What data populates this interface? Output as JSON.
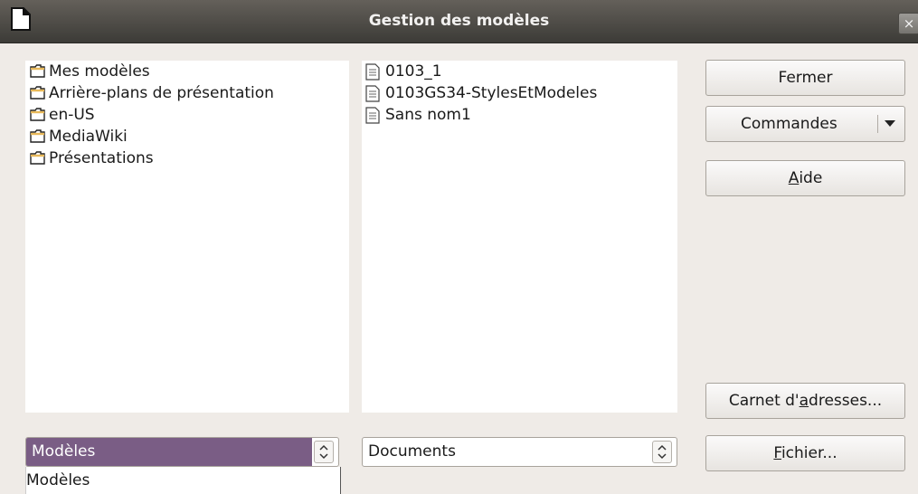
{
  "window": {
    "title": "Gestion des modèles",
    "close_label": "×"
  },
  "left_list": {
    "items": [
      {
        "label": "Mes modèles",
        "icon": "folder-icon"
      },
      {
        "label": "Arrière-plans de présentation",
        "icon": "folder-icon"
      },
      {
        "label": "en-US",
        "icon": "folder-icon"
      },
      {
        "label": "MediaWiki",
        "icon": "folder-icon"
      },
      {
        "label": "Présentations",
        "icon": "folder-icon"
      }
    ]
  },
  "right_list": {
    "items": [
      {
        "label": "0103_1",
        "icon": "document-icon"
      },
      {
        "label": "0103GS34-StylesEtModeles",
        "icon": "document-icon"
      },
      {
        "label": "Sans nom1",
        "icon": "document-icon"
      }
    ]
  },
  "buttons": {
    "fermer": "Fermer",
    "commandes": "Commandes",
    "aide_first": "A",
    "aide_rest": "ide",
    "carnet_pre": "Carnet d'",
    "carnet_u": "a",
    "carnet_post": "dresses...",
    "fichier_u": "F",
    "fichier_rest": "ichier..."
  },
  "left_select": {
    "value": "Modèles",
    "options": [
      "Modèles"
    ]
  },
  "right_select": {
    "value": "Documents"
  },
  "colors": {
    "selection": "#7a5d85",
    "titlebar": "#3c3b37"
  }
}
